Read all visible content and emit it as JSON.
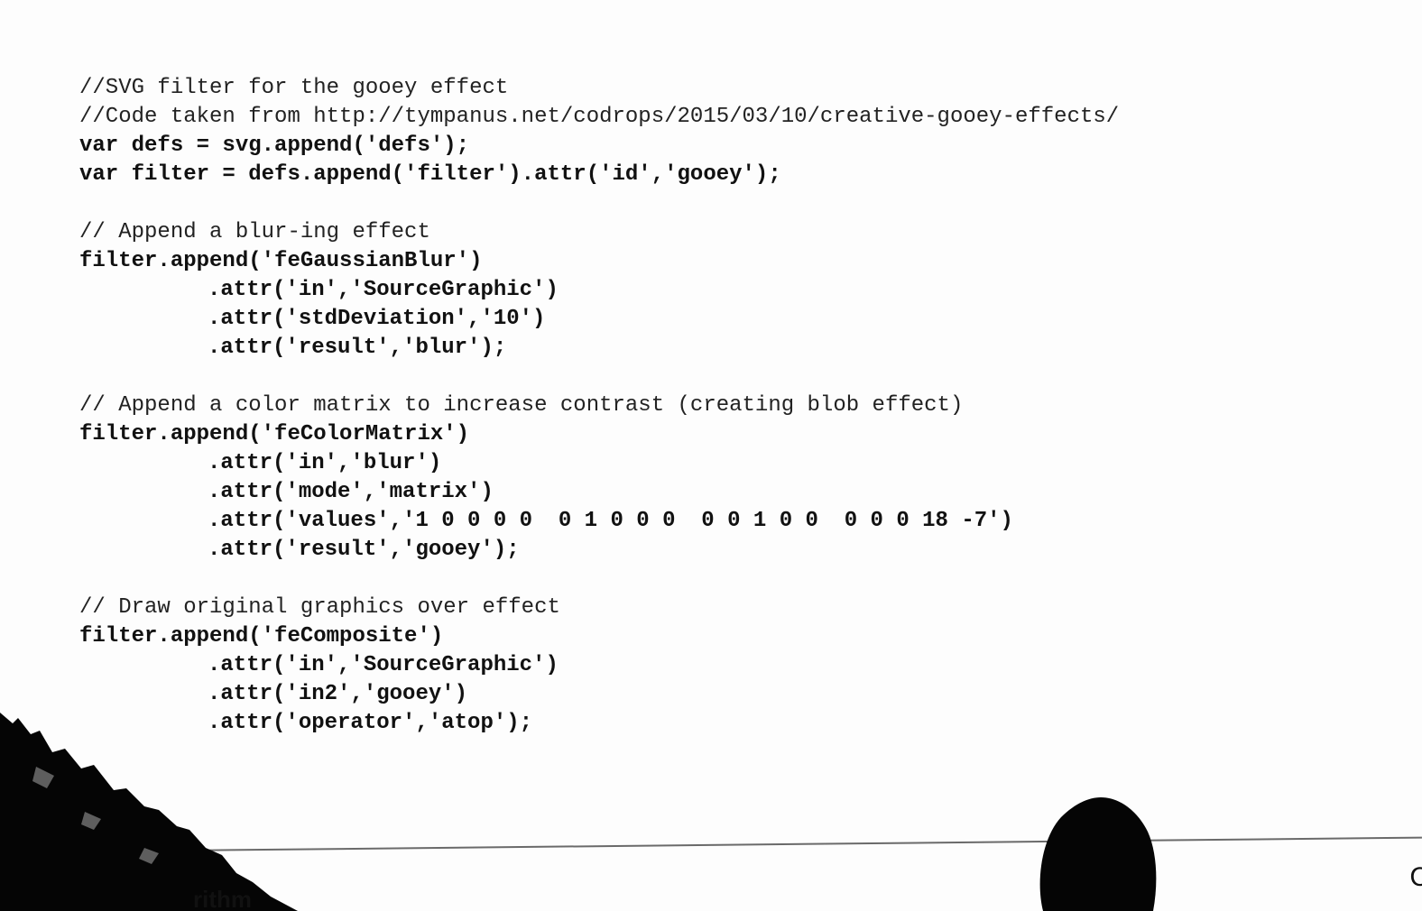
{
  "code_lines": [
    "//SVG filter for the gooey effect",
    "//Code taken from http://tympanus.net/codrops/2015/03/10/creative-gooey-effects/",
    "var defs = svg.append('defs');",
    "var filter = defs.append('filter').attr('id','gooey');",
    "",
    "// Append a blur-ing effect",
    "filter.append('feGaussianBlur')",
    ".attr('in','SourceGraphic')",
    ".attr('stdDeviation','10')",
    ".attr('result','blur');",
    "",
    "// Append a color matrix to increase contrast (creating blob effect)",
    "filter.append('feColorMatrix')",
    ".attr('in','blur')",
    ".attr('mode','matrix')",
    ".attr('values','1 0 0 0 0  0 1 0 0 0  0 0 1 0 0  0 0 0 18 -7')",
    ".attr('result','gooey');",
    "",
    "// Draw original graphics over effect",
    "filter.append('feComposite')",
    ".attr('in','SourceGraphic')",
    ".attr('in2','gooey')",
    ".attr('operator','atop');"
  ],
  "footer": {
    "partial_text": "rithm",
    "partial_right": "C"
  }
}
